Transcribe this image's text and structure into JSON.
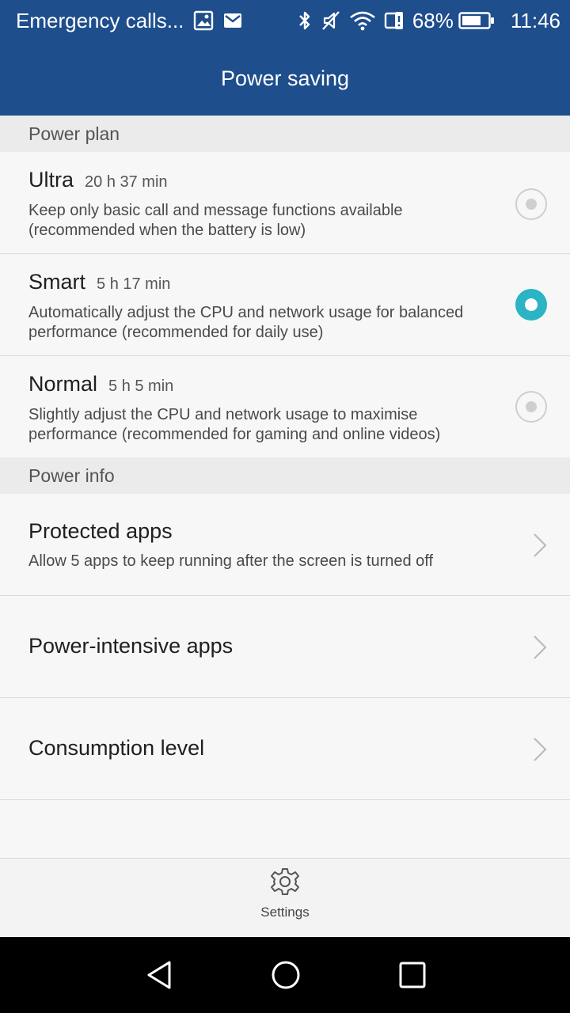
{
  "status_bar": {
    "carrier_text": "Emergency calls...",
    "battery_percent": "68%",
    "time": "11:46",
    "icons": [
      "gallery-icon",
      "mail-icon",
      "bluetooth-icon",
      "vibrate-off-icon",
      "wifi-icon",
      "battery-saver-icon",
      "battery-icon"
    ]
  },
  "app_bar": {
    "title": "Power saving"
  },
  "power_plan": {
    "header": "Power plan",
    "selected": "Smart",
    "plans": [
      {
        "name": "Ultra",
        "time": "20 h 37 min",
        "description": "Keep only basic call and message functions available (recommended when the battery is low)",
        "selected": false
      },
      {
        "name": "Smart",
        "time": "5 h 17 min",
        "description": "Automatically adjust the CPU and network usage for balanced performance (recommended for daily use)",
        "selected": true
      },
      {
        "name": "Normal",
        "time": "5 h 5 min",
        "description": "Slightly adjust the CPU and network usage to maximise performance (recommended for gaming and online videos)",
        "selected": false
      }
    ]
  },
  "power_info": {
    "header": "Power info",
    "items": [
      {
        "title": "Protected apps",
        "subtitle": "Allow 5 apps to keep running after the screen is turned off"
      },
      {
        "title": "Power-intensive apps"
      },
      {
        "title": "Consumption level"
      }
    ]
  },
  "bottom_bar": {
    "settings_label": "Settings"
  },
  "colors": {
    "accent": "#2ab4c4",
    "header_blue": "#1e4e8c",
    "section_bg": "#ebebeb",
    "background": "#f7f7f7"
  }
}
